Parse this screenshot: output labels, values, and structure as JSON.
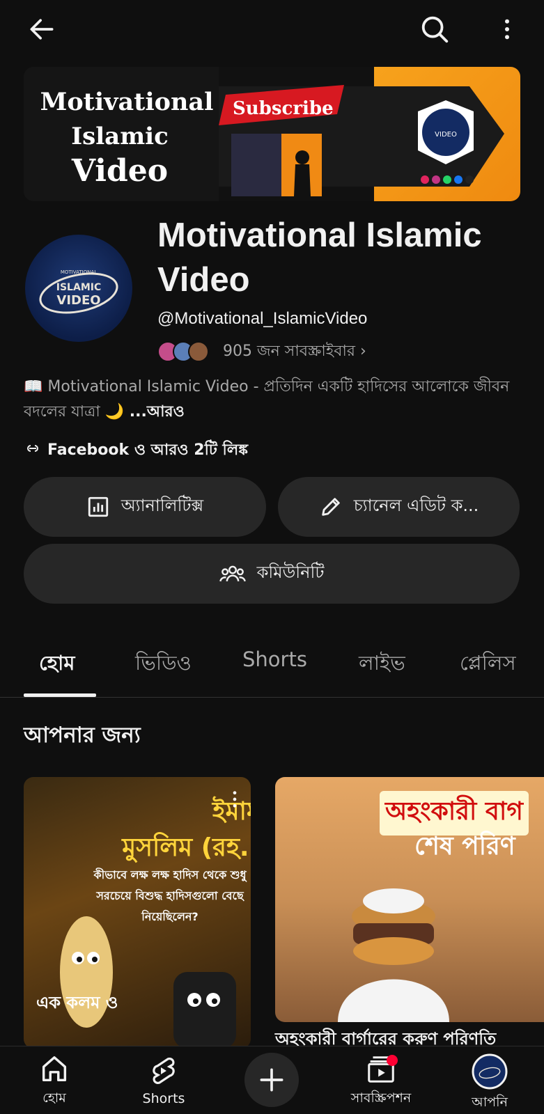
{
  "topbar": {
    "back_icon": "arrow-left-icon",
    "search_icon": "search-icon",
    "more_icon": "more-vertical-icon"
  },
  "banner": {
    "title_line1": "Motivational",
    "title_line2": "Islamic",
    "title_line3": "Video",
    "subscribe_label": "Subscribe",
    "logo_text": "VIDEO"
  },
  "channel": {
    "name": "Motivational Islamic Video",
    "handle": "@Motivational_IslamicVideo",
    "subscribers": "905 জন সাবস্ক্রাইবার ›",
    "avatar_text_top": "MOTIVATIONAL",
    "avatar_text_mid": "ISLAMIC",
    "avatar_text_bottom": "VIDEO",
    "description": "📖 Motivational Islamic Video - প্রতিদিন একটি হাদিসের আলোকে জীবন বদলের যাত্রা 🌙",
    "description_more": " ...আরও",
    "links": "Facebook ও আরও 2টি লিঙ্ক"
  },
  "actions": {
    "analytics": "অ্যানালিটিক্স",
    "edit": "চ্যানেল এডিট ক...",
    "community": "কমিউনিটি"
  },
  "tabs": [
    {
      "label": "হোম",
      "active": true
    },
    {
      "label": "ভিডিও",
      "active": false
    },
    {
      "label": "Shorts",
      "active": false
    },
    {
      "label": "লাইভ",
      "active": false
    },
    {
      "label": "প্লেলিস",
      "active": false
    }
  ],
  "section": {
    "title": "আপনার জন্য"
  },
  "cards": [
    {
      "title_line1": "ইমাম",
      "title_line2": "মুসলিম (রহ.)",
      "subtitle": "কীভাবে লক্ষ লক্ষ হাদিস থেকে শুধু সরচেয়ে বিশুদ্ধ হাদিসগুলো বেছে নিয়েছিলেন?",
      "caption": "এক কলম ও"
    },
    {
      "title_line1": "অহংকারী বাগ",
      "title_line2": "শেষ পরিণ",
      "caption": "অহংকারী বার্গারের করুণ পরিণতি"
    }
  ],
  "bottom_nav": [
    {
      "label": "হোম",
      "icon": "home-icon"
    },
    {
      "label": "Shorts",
      "icon": "shorts-icon"
    },
    {
      "label": "",
      "icon": "plus-icon"
    },
    {
      "label": "সাবস্ক্রিপশন",
      "icon": "subscriptions-icon"
    },
    {
      "label": "আপনি",
      "icon": "avatar-icon"
    }
  ],
  "colors": {
    "background": "#0f0f0f",
    "pill": "#272727",
    "text": "#f1f1f1",
    "secondary": "#aaaaaa",
    "notification": "#ff0033"
  }
}
